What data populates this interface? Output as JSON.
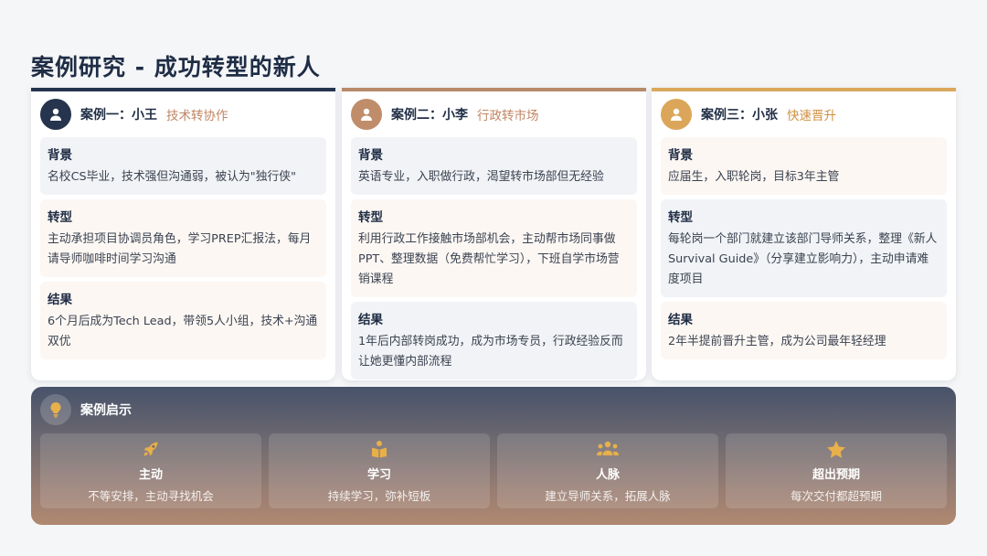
{
  "page": {
    "title": "案例研究 - 成功转型的新人"
  },
  "colors": {
    "navy": "#26344d",
    "brown": "#c08d6a",
    "gold": "#dca65a",
    "tip_icon": "#e8b04a"
  },
  "cases": [
    {
      "name": "案例一：小王",
      "tag": "技术转协作",
      "sections": [
        {
          "label": "背景",
          "text": "名校CS毕业，技术强但沟通弱，被认为\"独行侠\""
        },
        {
          "label": "转型",
          "text": "主动承担项目协调员角色，学习PREP汇报法，每月请导师咖啡时间学习沟通"
        },
        {
          "label": "结果",
          "text": "6个月后成为Tech Lead，带领5人小组，技术+沟通双优"
        }
      ]
    },
    {
      "name": "案例二：小李",
      "tag": "行政转市场",
      "sections": [
        {
          "label": "背景",
          "text": "英语专业，入职做行政，渴望转市场部但无经验"
        },
        {
          "label": "转型",
          "text": "利用行政工作接触市场部机会，主动帮市场同事做PPT、整理数据（免费帮忙学习），下班自学市场营销课程"
        },
        {
          "label": "结果",
          "text": "1年后内部转岗成功，成为市场专员，行政经验反而让她更懂内部流程"
        }
      ]
    },
    {
      "name": "案例三：小张",
      "tag": "快速晋升",
      "sections": [
        {
          "label": "背景",
          "text": "应届生，入职轮岗，目标3年主管"
        },
        {
          "label": "转型",
          "text": "每轮岗一个部门就建立该部门导师关系，整理《新人Survival Guide》（分享建立影响力），主动申请难度项目"
        },
        {
          "label": "结果",
          "text": "2年半提前晋升主管，成为公司最年轻经理"
        }
      ]
    }
  ],
  "insights": {
    "title": "案例启示",
    "items": [
      {
        "icon": "rocket-icon",
        "label": "主动",
        "text": "不等安排，主动寻找机会"
      },
      {
        "icon": "book-reader-icon",
        "label": "学习",
        "text": "持续学习，弥补短板"
      },
      {
        "icon": "people-icon",
        "label": "人脉",
        "text": "建立导师关系，拓展人脉"
      },
      {
        "icon": "star-icon",
        "label": "超出预期",
        "text": "每次交付都超预期"
      }
    ]
  }
}
